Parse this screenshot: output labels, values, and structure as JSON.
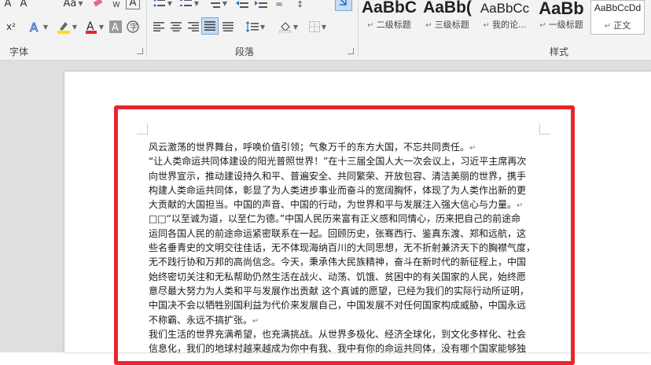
{
  "font_group": {
    "label": "字体",
    "row1": {
      "a_letter": "A",
      "aa_label": "Aa"
    },
    "row2": {
      "superscript": "x²"
    }
  },
  "paragraph_group": {
    "label": "段落"
  },
  "styles_group": {
    "label": "样式",
    "items": [
      {
        "sample": "AaBbC",
        "name": "二级标题"
      },
      {
        "sample": "AaBb(",
        "name": "三级标题"
      },
      {
        "sample": "AaBbCc",
        "name": "我的论..."
      },
      {
        "sample": "AaBb",
        "name": "一级标题"
      },
      {
        "sample": "AaBbCcDd",
        "name": "正文"
      }
    ]
  },
  "colors": {
    "highlight": "#f5e400",
    "font_color": "#e8262b",
    "frame": "#e8262b"
  },
  "document": {
    "paragraph_mark": "↵",
    "lines": [
      "风云激荡的世界舞台，呼唤价值引领；气象万千的东方大国，不忘共同责任。",
      "“让人类命运共同体建设的阳光普照世界！”在十三届全国人大一次会议上，习近平主席再次",
      "向世界宣示，推动建设持久和平、普遍安全、共同繁荣、开放包容、清洁美丽的世界，携手",
      "构建人类命运共同体，彰显了为人类进步事业而奋斗的宽阔胸怀，体现了为人类作出新的更",
      "大贡献的大国担当。中国的声音、中国的行动，为世界和平与发展注入强大信心与力量。",
      "□□“以至诚为道，以至仁为德。”中国人民历来富有正义感和同情心，历来把自己的前途命",
      "运同各国人民的前途命运紧密联系在一起。回顾历史，张骞西行、鉴真东渡、郑和远航，这",
      "些名垂青史的文明交往佳话，无不体现海纳百川的大同思想，无不折射兼济天下的胸襟气度，",
      "无不践行协和万邦的高尚信念。今天，秉承伟大民族精神，奋斗在新时代的新征程上，中国",
      "始终密切关注和无私帮助仍然生活在战火、动荡、饥饿、贫困中的有关国家的人民，始终愿",
      "意尽最大努力为人类和平与发展作出贡献 这个真诚的愿望，已经为我们的实际行动所证明，",
      "中国决不会以牺牲别国利益为代价来发展自己，中国发展不对任何国家构成威胁，中国永远",
      "不称霸、永远不搞扩张。",
      "我们生活的世界充满希望，也充满挑战。从世界多极化、经济全球化，到文化多样化、社会",
      "信息化，我们的地球村越来越成为你中有我、我中有你的命运共同体，没有哪个国家能够独"
    ]
  }
}
